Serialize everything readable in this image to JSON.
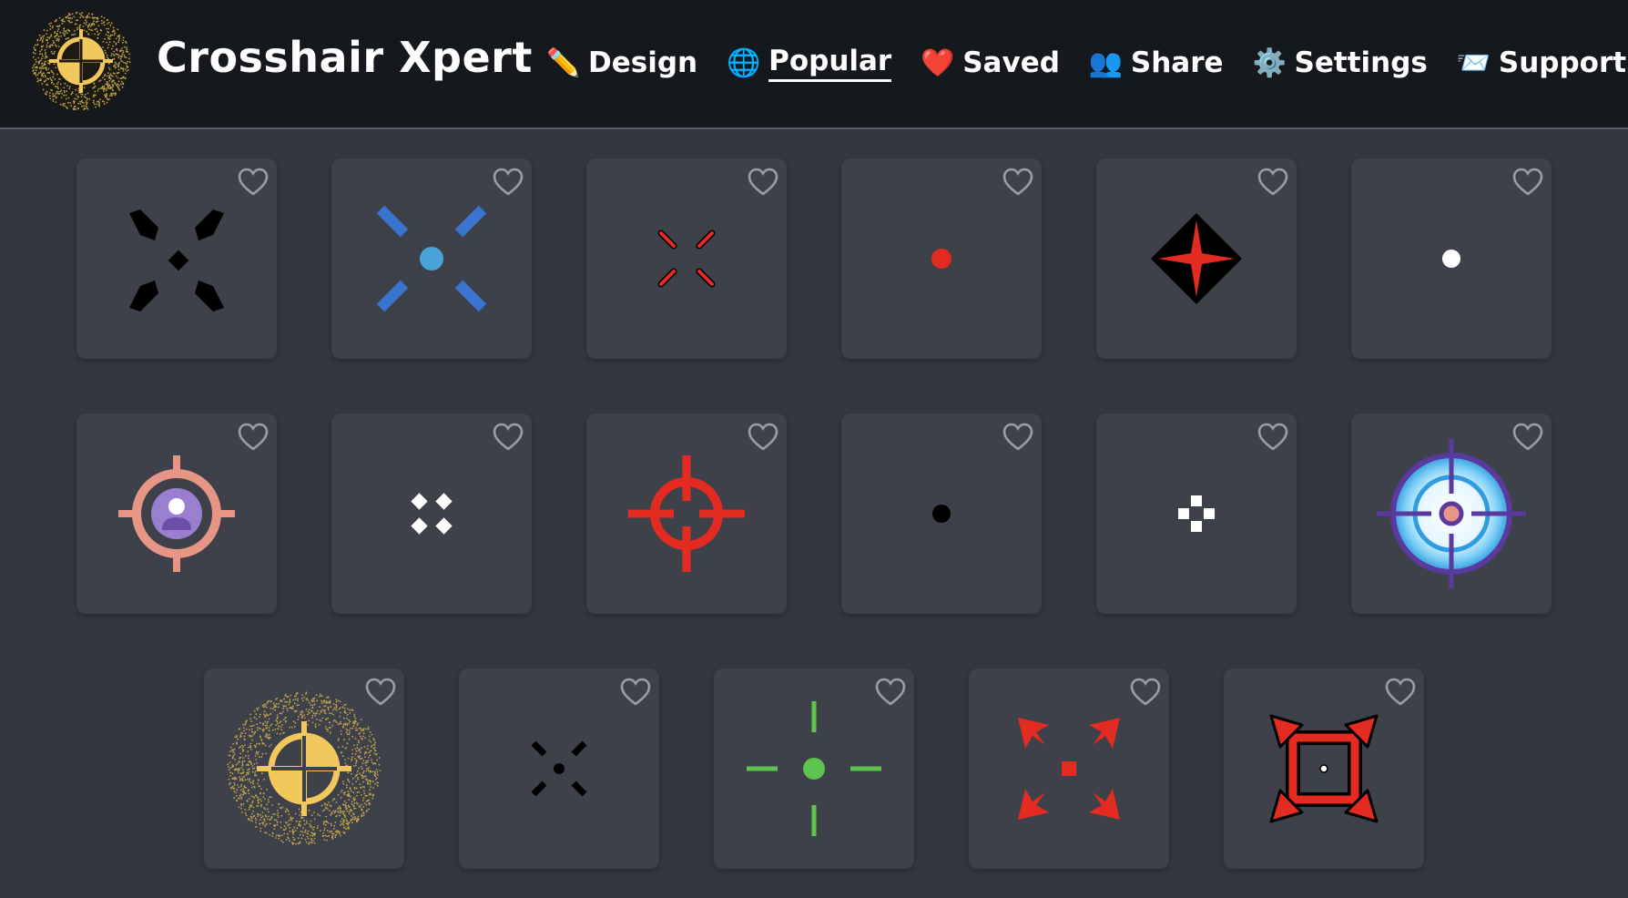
{
  "header": {
    "title": "Crosshair Xpert",
    "logo_icon": "crosshair-logo-icon"
  },
  "nav": [
    {
      "key": "design",
      "label": "Design",
      "emoji": "✏️",
      "icon": "pencil-icon",
      "active": false
    },
    {
      "key": "popular",
      "label": "Popular",
      "emoji": "🌐",
      "icon": "globe-icon",
      "active": true
    },
    {
      "key": "saved",
      "label": "Saved",
      "emoji": "❤️",
      "icon": "heart-icon",
      "active": false
    },
    {
      "key": "share",
      "label": "Share",
      "emoji": "👥",
      "icon": "people-icon",
      "active": false
    },
    {
      "key": "settings",
      "label": "Settings",
      "emoji": "⚙️",
      "icon": "gear-icon",
      "active": false
    },
    {
      "key": "support",
      "label": "Support",
      "emoji": "📨",
      "icon": "envelope-icon",
      "active": false
    }
  ],
  "colors": {
    "header_bg": "#15191e",
    "page_bg": "#343740",
    "tile_bg": "#3e4149",
    "heart_outline": "#9a9da3",
    "red": "#e32b22",
    "blue": "#3a74d0",
    "green": "#5ec44e",
    "gold": "#f2c75c"
  },
  "crosshairs": [
    {
      "id": "black-x-dot",
      "icon": "crosshair-black-x-icon",
      "favorited": false
    },
    {
      "id": "blue-x-dot",
      "icon": "crosshair-blue-x-icon",
      "favorited": false
    },
    {
      "id": "red-small-x",
      "icon": "crosshair-red-x-icon",
      "favorited": false
    },
    {
      "id": "red-dot",
      "icon": "crosshair-red-dot-icon",
      "favorited": false
    },
    {
      "id": "red-black-diamond",
      "icon": "crosshair-diamond-icon",
      "favorited": false
    },
    {
      "id": "white-dot",
      "icon": "crosshair-white-dot-icon",
      "favorited": false
    },
    {
      "id": "pink-ring-avatar",
      "icon": "crosshair-avatar-ring-icon",
      "favorited": false
    },
    {
      "id": "white-small-x",
      "icon": "crosshair-white-x-icon",
      "favorited": false
    },
    {
      "id": "red-scope",
      "icon": "crosshair-red-scope-icon",
      "favorited": false
    },
    {
      "id": "black-dot",
      "icon": "crosshair-black-dot-icon",
      "favorited": false
    },
    {
      "id": "white-plus-squares",
      "icon": "crosshair-white-squares-icon",
      "favorited": false
    },
    {
      "id": "purple-blue-target",
      "icon": "crosshair-blue-target-icon",
      "favorited": false
    },
    {
      "id": "gold-sparkle-scope",
      "icon": "crosshair-gold-scope-icon",
      "favorited": false
    },
    {
      "id": "black-small-x-dot",
      "icon": "crosshair-black-small-x-icon",
      "favorited": false
    },
    {
      "id": "green-cross-dot",
      "icon": "crosshair-green-cross-icon",
      "favorited": false
    },
    {
      "id": "red-arrows-square",
      "icon": "crosshair-red-arrows-icon",
      "favorited": false
    },
    {
      "id": "red-frame-square",
      "icon": "crosshair-red-frame-icon",
      "favorited": false
    }
  ]
}
